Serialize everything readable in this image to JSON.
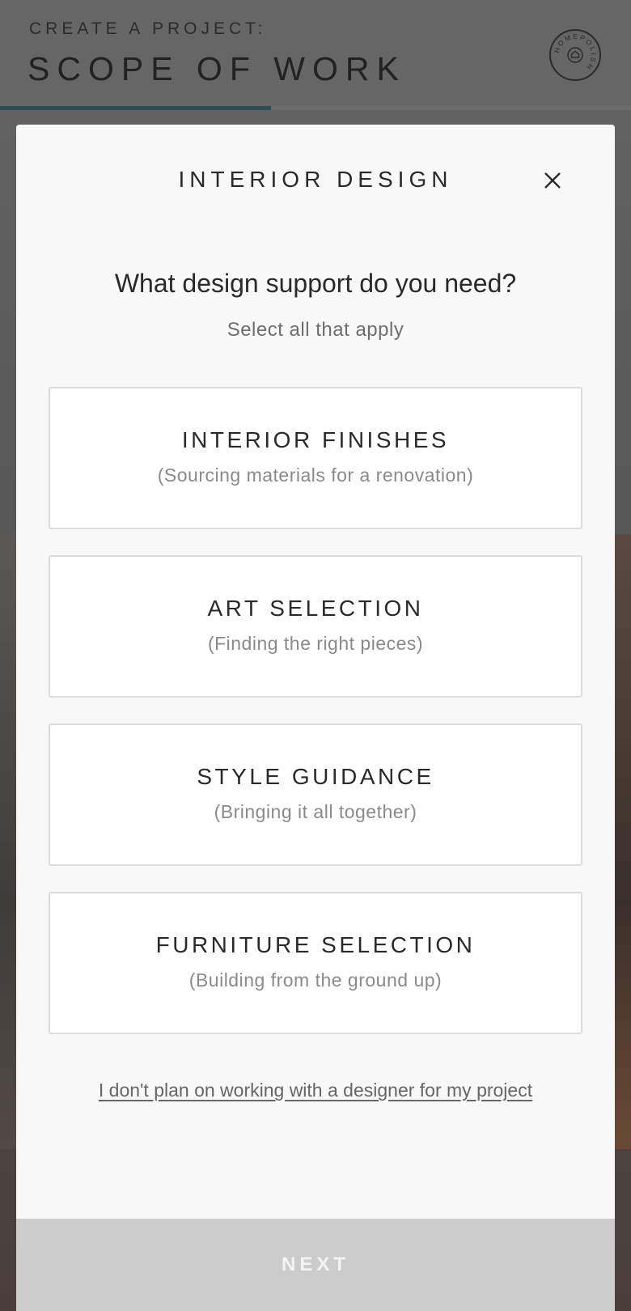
{
  "header": {
    "eyebrow": "CREATE A PROJECT:",
    "title": "SCOPE OF WORK",
    "progress_fraction": 0.43,
    "logo_text": "HOMEPOLISH"
  },
  "modal": {
    "title": "INTERIOR DESIGN",
    "question": "What design support do you need?",
    "hint": "Select all that apply",
    "options": [
      {
        "label": "INTERIOR FINISHES",
        "sub": "(Sourcing materials for a renovation)"
      },
      {
        "label": "ART SELECTION",
        "sub": "(Finding the right pieces)"
      },
      {
        "label": "STYLE GUIDANCE",
        "sub": "(Bringing it all together)"
      },
      {
        "label": "FURNITURE SELECTION",
        "sub": "(Building from the ground up)"
      }
    ],
    "no_designer_link": "I don't plan on working with a designer for my project"
  },
  "footer": {
    "next_label": "NEXT"
  },
  "colors": {
    "progress_accent": "#2f4d57",
    "next_button_bg": "#cccccc",
    "modal_bg": "#f8f8f8"
  },
  "icons": {
    "close": "close-icon",
    "logo": "homepolish-logo-icon"
  }
}
